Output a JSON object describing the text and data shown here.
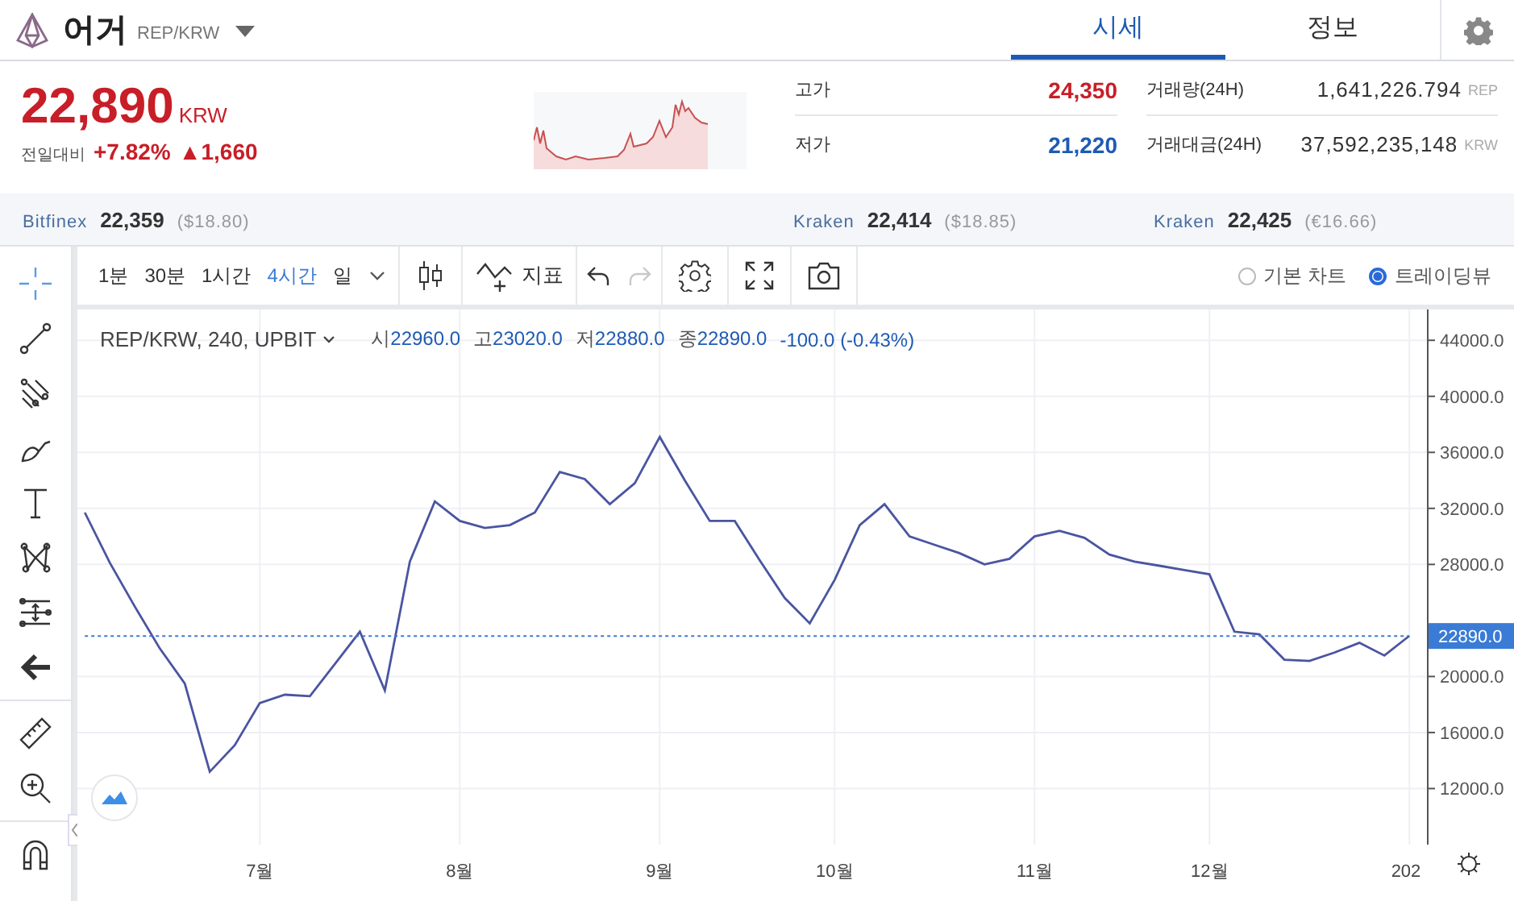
{
  "header": {
    "name": "어거",
    "pair": "REP/KRW",
    "tabs": [
      {
        "label": "시세",
        "selected": true
      },
      {
        "label": "정보",
        "selected": false
      }
    ]
  },
  "price": {
    "value": "22,890",
    "currency": "KRW",
    "change_label": "전일대비",
    "change_percent": "+7.82%",
    "change_amount": "▲1,660"
  },
  "stats": [
    {
      "label": "고가",
      "value": "24,350",
      "color": "#c81e28"
    },
    {
      "label": "저가",
      "value": "21,220",
      "color": "#1e5ab4"
    }
  ],
  "volumes": [
    {
      "label": "거래량(24H)",
      "value": "1,641,226.794",
      "unit": "REP"
    },
    {
      "label": "거래대금(24H)",
      "value": "37,592,235,148",
      "unit": "KRW"
    }
  ],
  "exchanges": [
    {
      "name": "Bitfinex",
      "price": "22,359",
      "foreign": "($18.80)"
    },
    {
      "name": "Kraken",
      "price": "22,414",
      "foreign": "($18.85)"
    },
    {
      "name": "Kraken",
      "price": "22,425",
      "foreign": "(€16.66)"
    }
  ],
  "toolbar": {
    "intervals": [
      {
        "label": "1분",
        "selected": false
      },
      {
        "label": "30분",
        "selected": false
      },
      {
        "label": "1시간",
        "selected": false
      },
      {
        "label": "4시간",
        "selected": true
      },
      {
        "label": "일",
        "selected": false
      }
    ],
    "indicator_label": "지표",
    "history": [
      {
        "kind": "undo",
        "disabled": false
      },
      {
        "kind": "redo",
        "disabled": true
      }
    ],
    "chart_types": [
      {
        "label": "기본 차트",
        "selected": false
      },
      {
        "label": "트레이딩뷰",
        "selected": true
      }
    ]
  },
  "drawing_tools": [
    {
      "kind": "crosshair",
      "selected": true
    },
    {
      "kind": "line",
      "selected": false
    },
    {
      "kind": "pitchfork",
      "selected": false
    },
    {
      "kind": "brush",
      "selected": false
    },
    {
      "kind": "text",
      "selected": false
    },
    {
      "kind": "pattern",
      "selected": false
    },
    {
      "kind": "measure",
      "selected": false
    },
    {
      "kind": "arrow",
      "selected": false
    },
    {
      "kind": "ruler",
      "selected": false
    },
    {
      "kind": "zoom",
      "selected": false
    },
    {
      "kind": "magnet",
      "selected": false
    }
  ],
  "legend": {
    "symbol": "REP/KRW, 240, UPBIT",
    "ohlc": [
      {
        "label": "시",
        "value": "22960.0"
      },
      {
        "label": "고",
        "value": "23020.0"
      },
      {
        "label": "저",
        "value": "22880.0"
      },
      {
        "label": "종",
        "value": "22890.0"
      }
    ],
    "change": "-100.0 (-0.43%)"
  },
  "chart_data": {
    "type": "line",
    "grid": true,
    "ylim": [
      8000,
      46200
    ],
    "categories": [
      null,
      null,
      null,
      null,
      null,
      null,
      null,
      "7월",
      null,
      null,
      null,
      null,
      null,
      null,
      null,
      "8월",
      null,
      null,
      null,
      null,
      null,
      null,
      null,
      "9월",
      null,
      null,
      null,
      null,
      null,
      null,
      "10월",
      null,
      null,
      null,
      null,
      null,
      null,
      null,
      "11월",
      null,
      null,
      null,
      null,
      null,
      null,
      "12월",
      null,
      null,
      null,
      null,
      null,
      null,
      null,
      "202"
    ],
    "series": [
      {
        "color": "#4a55a0",
        "values": [
          31700,
          28100,
          25000,
          22000,
          19500,
          13200,
          15100,
          18100,
          18700,
          18600,
          20900,
          23200,
          19000,
          28200,
          32500,
          31100,
          30600,
          30800,
          31700,
          34600,
          34100,
          32300,
          33800,
          37100,
          34000,
          31100,
          31100,
          28300,
          25600,
          23800,
          26900,
          30800,
          32300,
          30000,
          29400,
          28800,
          28000,
          28400,
          30000,
          30400,
          29900,
          28700,
          28200,
          27900,
          27600,
          27300,
          23200,
          23000,
          21200,
          21100,
          21700,
          22400,
          21500,
          22900
        ]
      },
      {
        "color": "#3a7bd5",
        "line_style": "dotted",
        "values": [
          22890,
          22890,
          22890,
          22890,
          22890,
          22890,
          22890,
          22890,
          22890,
          22890,
          22890,
          22890,
          22890,
          22890,
          22890,
          22890,
          22890,
          22890,
          22890,
          22890,
          22890,
          22890,
          22890,
          22890,
          22890,
          22890,
          22890,
          22890,
          22890,
          22890,
          22890,
          22890,
          22890,
          22890,
          22890,
          22890,
          22890,
          22890,
          22890,
          22890,
          22890,
          22890,
          22890,
          22890,
          22890,
          22890,
          22890,
          22890,
          22890,
          22890,
          22890,
          22890,
          22890,
          22890
        ]
      }
    ],
    "yticks": [
      {
        "value": 12000,
        "label": "12000.0"
      },
      {
        "value": 16000,
        "label": "16000.0"
      },
      {
        "value": 20000,
        "label": "20000.0"
      },
      {
        "value": 28000,
        "label": "28000.0"
      },
      {
        "value": 32000,
        "label": "32000.0"
      },
      {
        "value": 36000,
        "label": "36000.0"
      },
      {
        "value": 40000,
        "label": "40000.0"
      },
      {
        "value": 44000,
        "label": "44000.0"
      }
    ],
    "annotations": [
      "22890.0"
    ]
  }
}
